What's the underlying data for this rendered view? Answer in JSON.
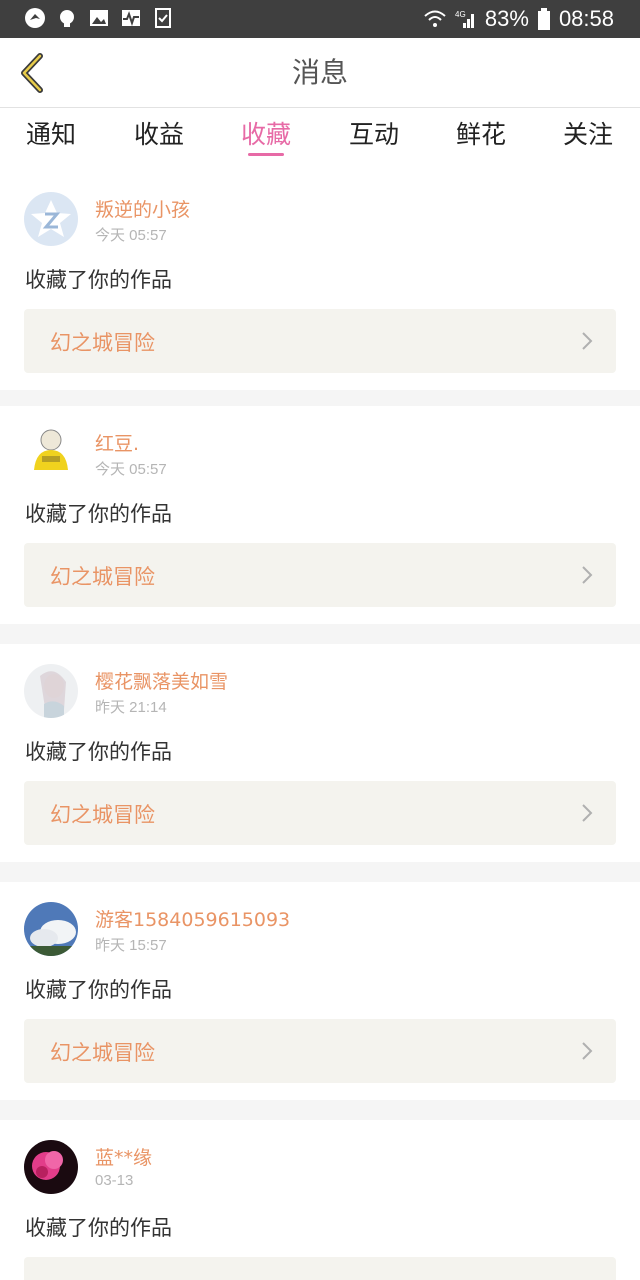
{
  "status_bar": {
    "battery": "83%",
    "time": "08:58",
    "signal_label": "4G",
    "icons": [
      "bird-icon",
      "lightbulb-icon",
      "image-icon",
      "pulse-icon",
      "clipboard-check-icon",
      "wifi-icon",
      "cell-signal-icon",
      "battery-icon"
    ]
  },
  "header": {
    "title": "消息",
    "back_icon": "chevron-left-icon"
  },
  "tabs": [
    {
      "label": "通知",
      "active": false
    },
    {
      "label": "收益",
      "active": false
    },
    {
      "label": "收藏",
      "active": true
    },
    {
      "label": "互动",
      "active": false
    },
    {
      "label": "鲜花",
      "active": false
    },
    {
      "label": "关注",
      "active": false
    }
  ],
  "colors": {
    "accent": "#e76aa6",
    "name": "#e99465",
    "work_bg": "#f4f3ee"
  },
  "items": [
    {
      "name": "叛逆的小孩",
      "time": "今天 05:57",
      "message": "收藏了你的作品",
      "work": "幻之城冒险",
      "avatar": "qq-logo-avatar"
    },
    {
      "name": "红豆.",
      "time": "今天 05:57",
      "message": "收藏了你的作品",
      "work": "幻之城冒险",
      "avatar": "cartoon-yellow-sweater-avatar"
    },
    {
      "name": "樱花飘落美如雪",
      "time": "昨天 21:14",
      "message": "收藏了你的作品",
      "work": "幻之城冒险",
      "avatar": "anime-girl-avatar"
    },
    {
      "name": "游客1584059615093",
      "time": "昨天 15:57",
      "message": "收藏了你的作品",
      "work": "幻之城冒险",
      "avatar": "sky-clouds-avatar"
    },
    {
      "name": "蓝**缘",
      "time": "03-13",
      "message": "收藏了你的作品",
      "work": "",
      "avatar": "pink-flower-avatar"
    }
  ]
}
